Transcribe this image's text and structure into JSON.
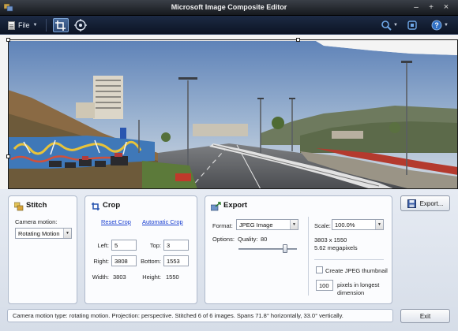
{
  "window": {
    "title": "Microsoft Image Composite Editor",
    "minimize": "–",
    "maximize": "+",
    "close": "×"
  },
  "toolbar": {
    "file_label": "File",
    "tools": [
      "crop-tool",
      "rotate-tool",
      "zoom-tool",
      "fit-view-tool",
      "help"
    ]
  },
  "stitch": {
    "title": "Stitch",
    "camera_motion_label": "Camera motion:",
    "camera_motion_value": "Rotating Motion"
  },
  "crop": {
    "title": "Crop",
    "reset_link": "Reset Crop",
    "auto_link": "Automatic Crop",
    "left_label": "Left:",
    "left_value": "5",
    "top_label": "Top:",
    "top_value": "3",
    "right_label": "Right:",
    "right_value": "3808",
    "bottom_label": "Bottom:",
    "bottom_value": "1553",
    "width_label": "Width:",
    "width_value": "3803",
    "height_label": "Height:",
    "height_value": "1550"
  },
  "export": {
    "title": "Export",
    "format_label": "Format:",
    "format_value": "JPEG Image",
    "options_label": "Options:",
    "quality_label": "Quality:",
    "quality_value": "80",
    "quality_fraction": 0.8,
    "scale_label": "Scale:",
    "scale_value": "100.0%",
    "dimensions": "3803 x 1550",
    "megapixels": "5.62 megapixels",
    "thumbnail_label": "Create JPEG thumbnail",
    "thumbnail_checked": false,
    "thumb_pixels_value": "100",
    "thumb_pixels_label_1": "pixels in longest",
    "thumb_pixels_label_2": "dimension",
    "export_button": "Export..."
  },
  "status_text": "Camera motion type: rotating motion. Projection: perspective. Stitched 6 of 6 images. Spans 71.8° horizontally, 33.0° vertically.",
  "exit_button": "Exit",
  "colors": {
    "titlebar": "#1c2026",
    "toolbar": "#12203a",
    "link": "#1a3fd0",
    "panel_border": "#aeb9cb"
  }
}
